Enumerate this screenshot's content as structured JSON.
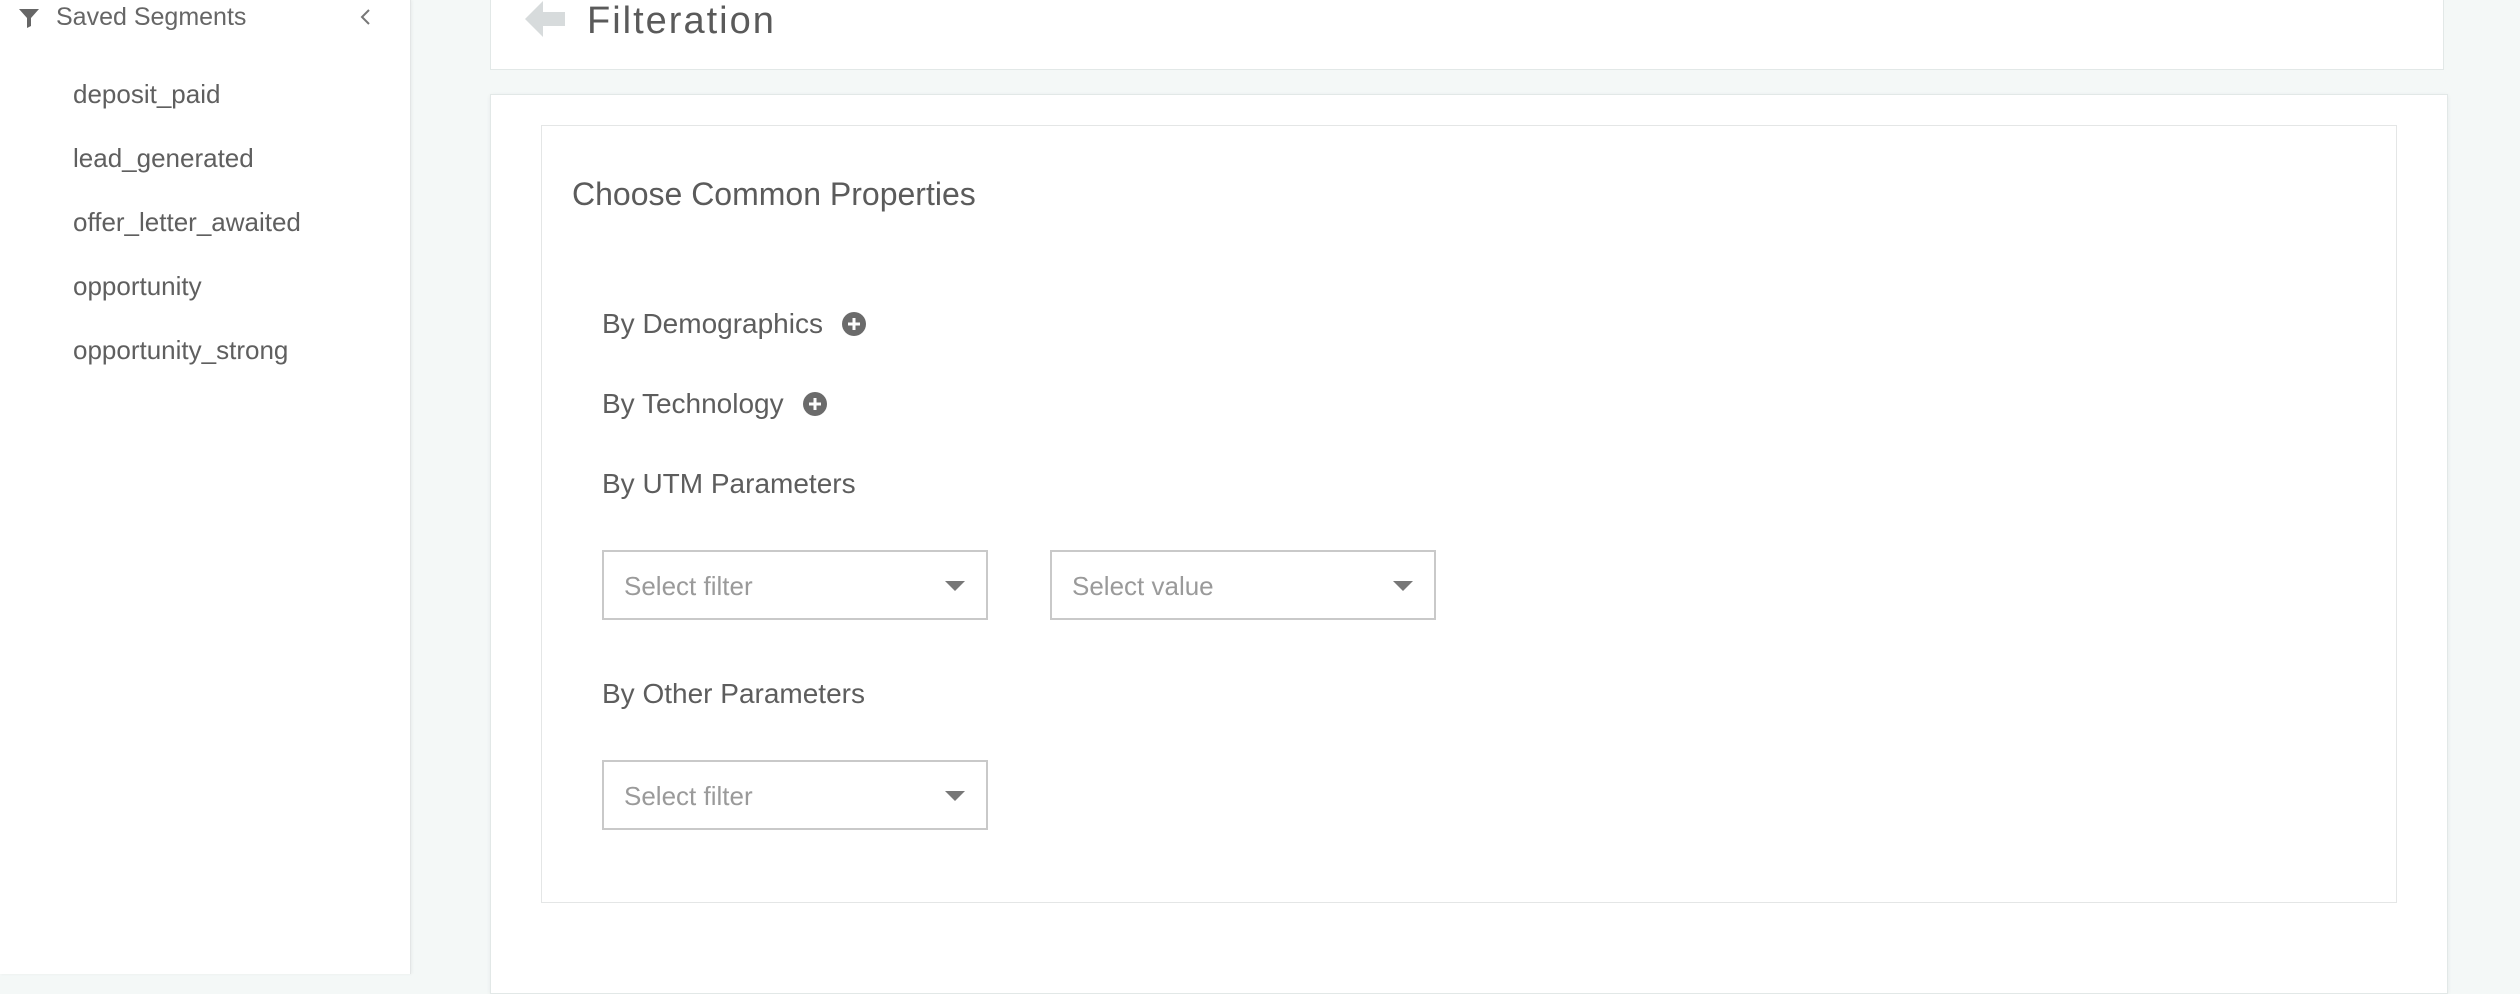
{
  "sidebar": {
    "title": "Saved Segments",
    "items": [
      {
        "label": "deposit_paid"
      },
      {
        "label": "lead_generated"
      },
      {
        "label": "offer_letter_awaited"
      },
      {
        "label": "opportunity"
      },
      {
        "label": "opportunity_strong"
      }
    ]
  },
  "header": {
    "title": "Filteration"
  },
  "main": {
    "section_title": "Choose Common Properties",
    "demographics_label": "By Demographics",
    "technology_label": "By Technology",
    "utm_label": "By UTM Parameters",
    "utm_filter_placeholder": "Select filter",
    "utm_value_placeholder": "Select value",
    "other_label": "By Other Parameters",
    "other_filter_placeholder": "Select filter"
  },
  "icons": {
    "filter": "filter-icon",
    "collapse": "chevron-left-icon",
    "back": "arrow-left-icon",
    "add": "plus-circle-icon",
    "caret": "caret-down-icon"
  },
  "colors": {
    "background": "#f4f8f7",
    "card": "#ffffff",
    "text": "#5d5d5d",
    "placeholder": "#9a9a9a",
    "border": "#c9c9c9",
    "back_arrow": "#d7dbdc"
  }
}
